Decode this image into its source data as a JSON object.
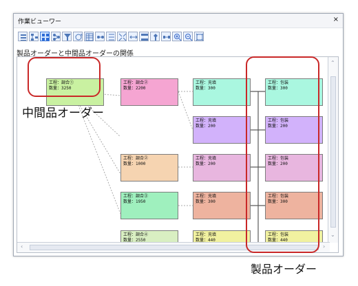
{
  "window": {
    "title": "作業ビューワー",
    "close_label": "×"
  },
  "toolbar": {
    "buttons": [
      {
        "icon": "list-icon"
      },
      {
        "icon": "tree-icon"
      },
      {
        "icon": "grid-icon"
      },
      {
        "icon": "network-icon"
      },
      {
        "icon": "filter-icon"
      },
      {
        "icon": "refresh-icon"
      },
      {
        "icon": "table-icon"
      },
      {
        "icon": "link-icon"
      },
      {
        "icon": "tree2-icon"
      },
      {
        "icon": "expand-icon"
      },
      {
        "icon": "arrows-icon"
      },
      {
        "icon": "nodes-icon"
      },
      {
        "icon": "pin-icon"
      },
      {
        "icon": "connector-icon"
      },
      {
        "icon": "zoom-in-icon"
      },
      {
        "icon": "zoom-out-icon"
      },
      {
        "icon": "fit-icon"
      }
    ]
  },
  "header": {
    "relation_title": "製品オーダーと中間品オーダーの関係"
  },
  "annotations": {
    "intermediate": "中間品オーダー",
    "product": "製品オーダー"
  },
  "nodes": [
    {
      "id": "n1",
      "line1": "工程：調合①",
      "line2": "数量：3250",
      "color": "#c9f1a1"
    },
    {
      "id": "n2",
      "line1": "工程：調合②",
      "line2": "数量：2200",
      "color": "#f5a5d2"
    },
    {
      "id": "n3",
      "line1": "工程：充填",
      "line2": "数量：300",
      "color": "#aaf7e0"
    },
    {
      "id": "n4",
      "line1": "工程：包装",
      "line2": "数量：300",
      "color": "#aaf7e0"
    },
    {
      "id": "n5",
      "line1": "工程：充填",
      "line2": "数量：200",
      "color": "#d2b2fb"
    },
    {
      "id": "n6",
      "line1": "工程：包装",
      "line2": "数量：200",
      "color": "#d2b2fb"
    },
    {
      "id": "n7",
      "line1": "工程：調合②",
      "line2": "数量：1000",
      "color": "#f6d4b1"
    },
    {
      "id": "n8",
      "line1": "工程：充填",
      "line2": "数量：200",
      "color": "#e8b6df"
    },
    {
      "id": "n9",
      "line1": "工程：包装",
      "line2": "数量：200",
      "color": "#e8b6df"
    },
    {
      "id": "n10",
      "line1": "工程：調合③",
      "line2": "数量：1950",
      "color": "#9ff0be"
    },
    {
      "id": "n11",
      "line1": "工程：充填",
      "line2": "数量：300",
      "color": "#eeb39f"
    },
    {
      "id": "n12",
      "line1": "工程：包装",
      "line2": "数量：300",
      "color": "#eeb39f"
    },
    {
      "id": "n13",
      "line1": "工程：調合④",
      "line2": "数量：2550",
      "color": "#d9efc2"
    },
    {
      "id": "n14",
      "line1": "工程：充填",
      "line2": "数量：440",
      "color": "#f1f1a0"
    },
    {
      "id": "n15",
      "line1": "工程：包装",
      "line2": "数量：440",
      "color": "#f1f1a0"
    }
  ]
}
